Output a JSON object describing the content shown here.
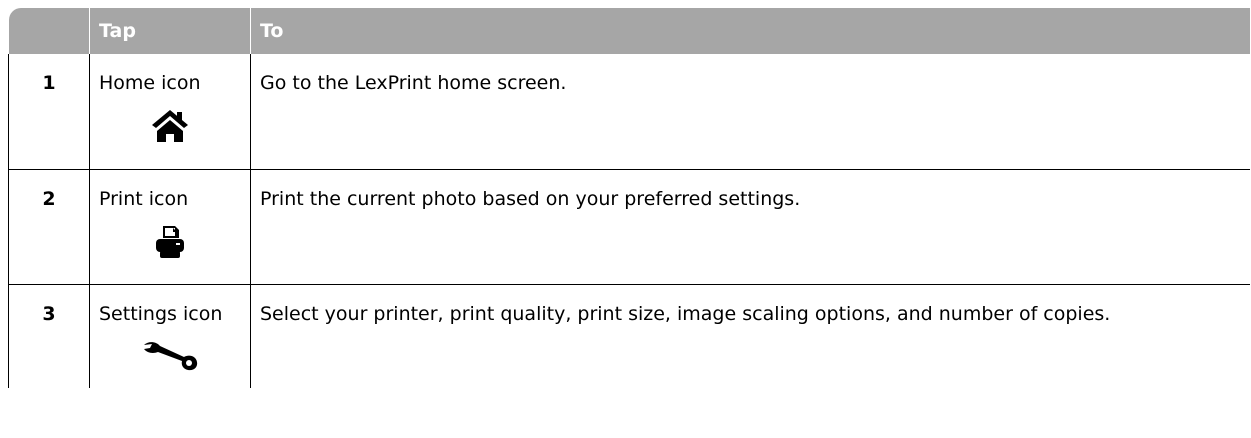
{
  "table": {
    "headers": [
      "",
      "Tap",
      "To"
    ],
    "rows": [
      {
        "number": "1",
        "tap": "Home icon",
        "icon": "home-icon",
        "to": "Go to the LexPrint home screen."
      },
      {
        "number": "2",
        "tap": "Print icon",
        "icon": "printer-icon",
        "to": "Print the current photo based on your preferred settings."
      },
      {
        "number": "3",
        "tap": "Settings icon",
        "icon": "wrench-icon",
        "to": "Select your printer, print quality, print size, image scaling options, and number of copies."
      }
    ]
  },
  "colors": {
    "header_background": "#a6a6a6",
    "header_text": "#ffffff",
    "body_text": "#000000",
    "border": "#000000"
  }
}
